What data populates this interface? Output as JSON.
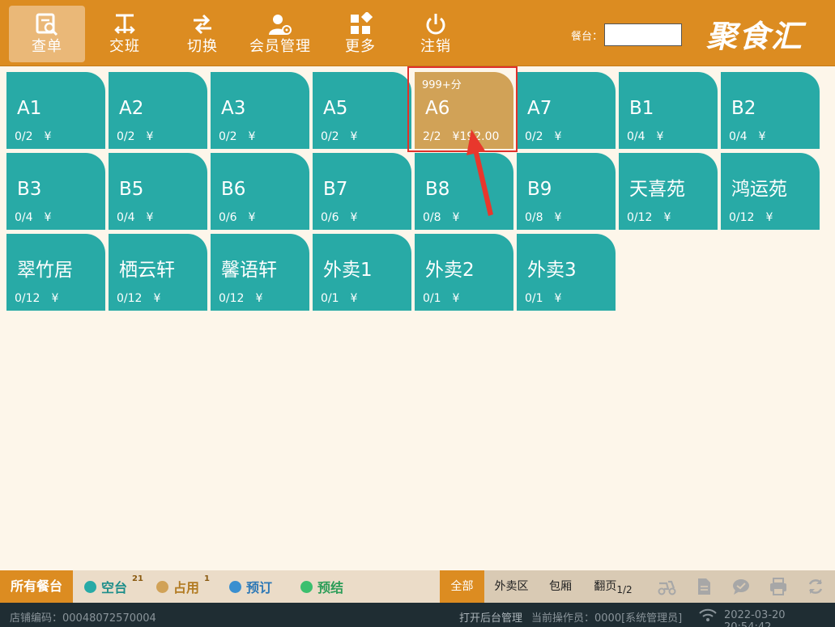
{
  "toolbar": {
    "buttons": [
      {
        "label": "查单",
        "icon": "search-order-icon"
      },
      {
        "label": "交班",
        "icon": "handover-icon"
      },
      {
        "label": "切换",
        "icon": "switch-icon"
      },
      {
        "label": "会员管理",
        "icon": "member-icon"
      },
      {
        "label": "更多",
        "icon": "more-grid-icon"
      },
      {
        "label": "注销",
        "icon": "power-icon"
      }
    ],
    "table_search_label": "餐台：",
    "table_search_value": "",
    "logo": "聚食汇"
  },
  "tables": [
    {
      "name": "A1",
      "seats": "0/2",
      "amount": "¥"
    },
    {
      "name": "A2",
      "seats": "0/2",
      "amount": "¥"
    },
    {
      "name": "A3",
      "seats": "0/2",
      "amount": "¥"
    },
    {
      "name": "A5",
      "seats": "0/2",
      "amount": "¥"
    },
    {
      "name": "A6",
      "seats": "2/2",
      "amount": "¥192.00",
      "tag": "999+分",
      "status": "occupied"
    },
    {
      "name": "A7",
      "seats": "0/2",
      "amount": "¥"
    },
    {
      "name": "B1",
      "seats": "0/4",
      "amount": "¥"
    },
    {
      "name": "B2",
      "seats": "0/4",
      "amount": "¥"
    },
    {
      "name": "B3",
      "seats": "0/4",
      "amount": "¥"
    },
    {
      "name": "B5",
      "seats": "0/4",
      "amount": "¥"
    },
    {
      "name": "B6",
      "seats": "0/6",
      "amount": "¥"
    },
    {
      "name": "B7",
      "seats": "0/6",
      "amount": "¥"
    },
    {
      "name": "B8",
      "seats": "0/8",
      "amount": "¥"
    },
    {
      "name": "B9",
      "seats": "0/8",
      "amount": "¥"
    },
    {
      "name": "天喜苑",
      "seats": "0/12",
      "amount": "¥"
    },
    {
      "name": "鸿运苑",
      "seats": "0/12",
      "amount": "¥"
    },
    {
      "name": "翠竹居",
      "seats": "0/12",
      "amount": "¥"
    },
    {
      "name": "栖云轩",
      "seats": "0/12",
      "amount": "¥"
    },
    {
      "name": "馨语轩",
      "seats": "0/12",
      "amount": "¥"
    },
    {
      "name": "外卖1",
      "seats": "0/1",
      "amount": "¥"
    },
    {
      "name": "外卖2",
      "seats": "0/1",
      "amount": "¥"
    },
    {
      "name": "外卖3",
      "seats": "0/1",
      "amount": "¥"
    }
  ],
  "status": {
    "all_label": "所有餐台",
    "legend": [
      {
        "label": "空台",
        "count": "21",
        "color": "#28aaa6"
      },
      {
        "label": "占用",
        "count": "1",
        "color": "#d1a257"
      },
      {
        "label": "预订",
        "count": "",
        "color": "#3a8fd0"
      },
      {
        "label": "预结",
        "count": "",
        "color": "#3bbf6e"
      }
    ],
    "filters": [
      "全部",
      "外卖区",
      "包厢"
    ],
    "page_label": "翻页",
    "page_value": "1/2",
    "icons": [
      "delivery-icon",
      "document-icon",
      "chat-icon",
      "printer-icon",
      "refresh-icon"
    ]
  },
  "footer": {
    "store_code": "店铺编码：00048072570004",
    "backend": "打开后台管理",
    "operator": "当前操作员：0000[系统管理员]",
    "datetime": "2022-03-20 20:54:42"
  },
  "colors": {
    "accent": "#dc8c21",
    "free": "#28aaa6",
    "occupied": "#d1a257"
  }
}
